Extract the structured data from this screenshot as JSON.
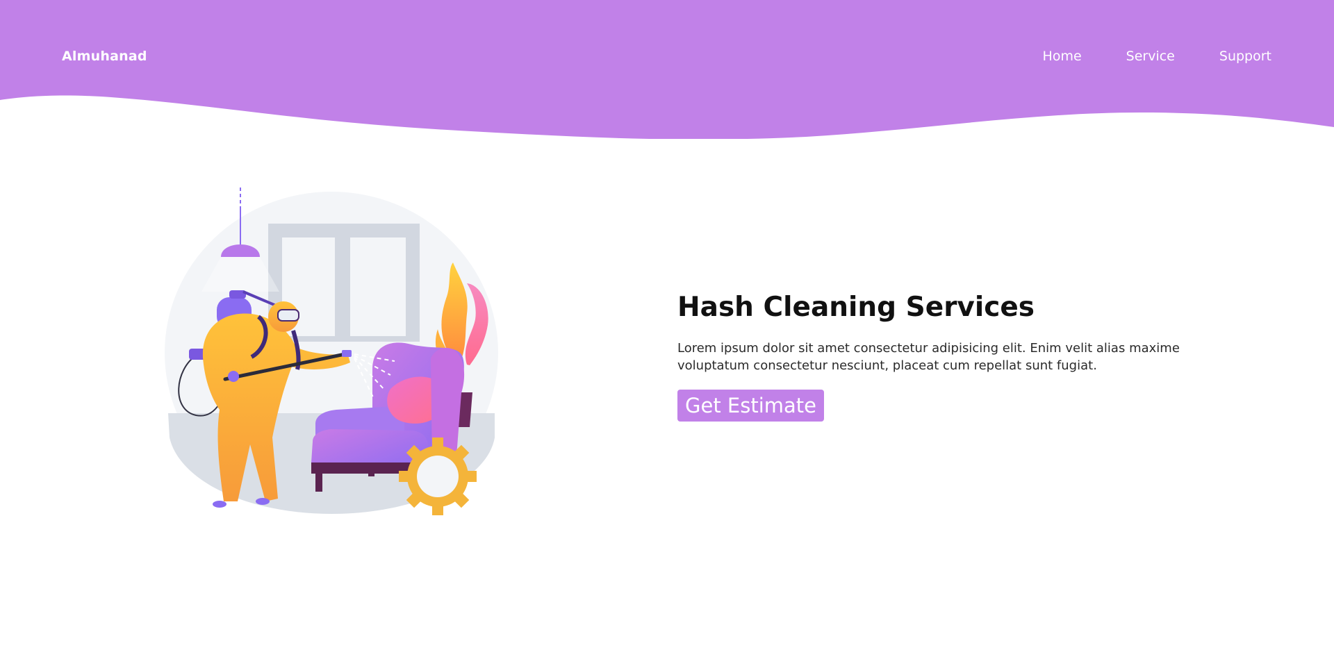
{
  "brand": {
    "name": "Almuhanad"
  },
  "nav": {
    "items": [
      {
        "label": "Home"
      },
      {
        "label": "Service"
      },
      {
        "label": "Support"
      }
    ]
  },
  "hero": {
    "title": "Hash Cleaning Services",
    "description": "Lorem ipsum dolor sit amet consectetur adipisicing elit. Enim velit alias maxime voluptatum consectetur nesciunt, placeat cum repellat sunt fugiat.",
    "cta_label": "Get Estimate"
  },
  "theme": {
    "accent": "#c181e8",
    "text_dark": "#111111"
  }
}
